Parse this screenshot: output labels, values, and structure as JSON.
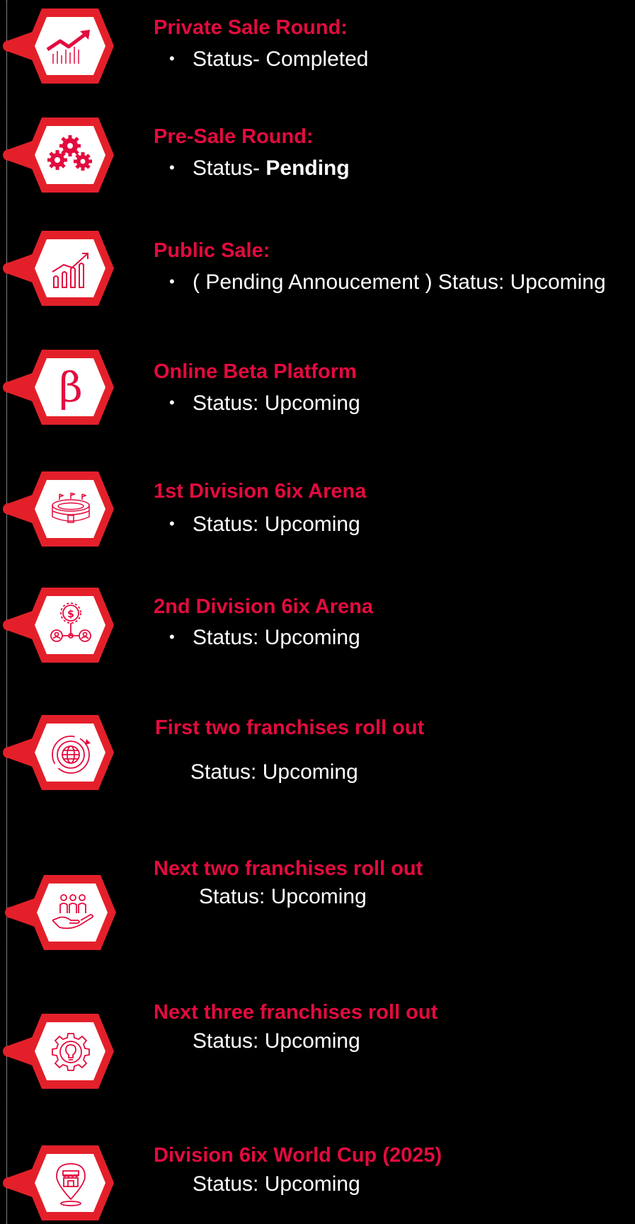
{
  "colors": {
    "accent": "#e30b3e",
    "badge_outer": "#e3202a",
    "text": "#ffffff",
    "background": "#000000"
  },
  "milestones": [
    {
      "title": "Private Sale Round:",
      "status_prefix": "Status- ",
      "status_value": "Completed",
      "icon": "trending-up-chart-icon"
    },
    {
      "title": "Pre-Sale Round:",
      "status_prefix": "Status- ",
      "status_value": "Pending",
      "icon": "gears-icon"
    },
    {
      "title": "Public Sale:",
      "status_prefix": "( Pending Annoucement ) Status: ",
      "status_value": "Upcoming",
      "icon": "growth-bars-icon"
    },
    {
      "title": "Online Beta Platform",
      "status_prefix": "Status: ",
      "status_value": "Upcoming",
      "icon": "beta-icon"
    },
    {
      "title": "1st Division 6ix Arena",
      "status_prefix": "Status: ",
      "status_value": "Upcoming",
      "icon": "stadium-icon"
    },
    {
      "title": "2nd Division 6ix Arena",
      "status_prefix": "Status: ",
      "status_value": "Upcoming",
      "icon": "money-network-icon"
    },
    {
      "title": "First two franchises roll out",
      "status_prefix": "Status: ",
      "status_value": "Upcoming",
      "icon": "globe-icon"
    },
    {
      "title": "Next two franchises roll out",
      "status_prefix": "Status: ",
      "status_value": "Upcoming",
      "icon": "people-hand-icon"
    },
    {
      "title": "Next three franchises roll out",
      "status_prefix": "Status: ",
      "status_value": "Upcoming",
      "icon": "gear-bulb-icon"
    },
    {
      "title": "Division 6ix World Cup (2025)",
      "status_prefix": "Status: ",
      "status_value": "Upcoming",
      "icon": "store-location-icon"
    }
  ]
}
